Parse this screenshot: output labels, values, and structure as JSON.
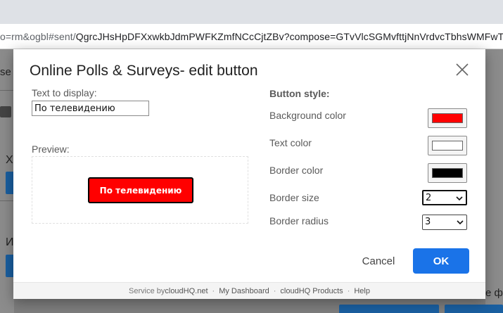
{
  "browser": {
    "url_prefix": "o=rm&ogbl#sent/",
    "url_rest": "QgrcJHsHpDFXxwkbJdmPWFKZmfNCcCjtZBv?compose=GTvVlcSGMvfttjNnVrdvcTbhsWMFwTVxXF"
  },
  "background": {
    "left_text1": "se",
    "left_text2": "X",
    "left_text3": "И",
    "right_text": "е фи"
  },
  "dialog": {
    "title": "Online Polls & Surveys- edit button",
    "text_to_display_label": "Text to display:",
    "text_value": "По телевидению",
    "preview_label": "Preview:",
    "preview_button_text": "По телевидению",
    "button_style_label": "Button style:",
    "background_color_label": "Background color",
    "text_color_label": "Text color",
    "border_color_label": "Border color",
    "border_size_label": "Border size",
    "border_radius_label": "Border radius",
    "border_size_value": "2",
    "border_radius_value": "3",
    "colors": {
      "background": "#ff0000",
      "text": "#ffffff",
      "border": "#000000",
      "ok_button": "#1a73e8"
    },
    "cancel_label": "Cancel",
    "ok_label": "OK"
  },
  "footer": {
    "service_by": "Service by ",
    "cloudhq": "cloudHQ.net",
    "sep": "·",
    "dashboard": "My Dashboard",
    "products": "cloudHQ Products",
    "help": "Help"
  },
  "icons": {
    "close": "close-icon",
    "chevron": "chevron-down-icon"
  }
}
